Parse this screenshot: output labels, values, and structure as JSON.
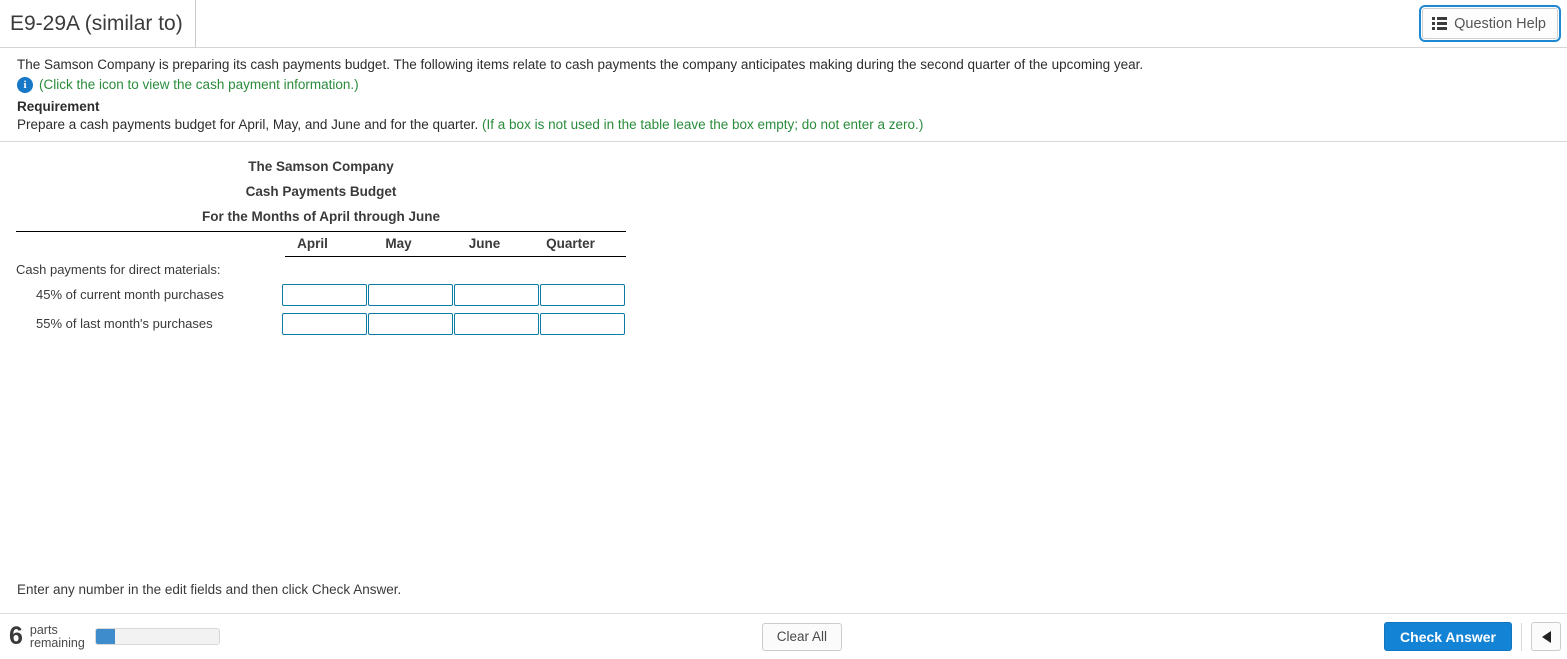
{
  "header": {
    "title": "E9-29A (similar to)",
    "question_help_label": "Question Help",
    "question_help_icon": "list-icon"
  },
  "problem": {
    "intro": "The Samson Company is preparing its cash payments budget. The following items relate to cash payments the company anticipates making during the second quarter of the upcoming year.",
    "info_icon": "info-icon",
    "info_link": "(Click the icon to view the cash payment information.)",
    "requirement_label": "Requirement",
    "requirement_text": "Prepare a cash payments budget for April, May, and June and for the quarter.",
    "requirement_hint": "(If a box is not used in the table leave the box empty; do not enter a zero.)"
  },
  "table": {
    "title_line1": "The Samson Company",
    "title_line2": "Cash Payments Budget",
    "title_line3": "For the Months of April through June",
    "columns": [
      "April",
      "May",
      "June",
      "Quarter"
    ],
    "section_label": "Cash payments for direct materials:",
    "rows": [
      {
        "label": "45% of current month purchases",
        "values": [
          "",
          "",
          "",
          ""
        ]
      },
      {
        "label": "55% of last month's purchases",
        "values": [
          "",
          "",
          "",
          ""
        ]
      }
    ]
  },
  "instruction": "Enter any number in the edit fields and then click Check Answer.",
  "footer": {
    "parts_count": "6",
    "parts_label_line1": "parts",
    "parts_label_line2": "remaining",
    "progress_percent": 16,
    "clear_all_label": "Clear All",
    "check_answer_label": "Check Answer",
    "prev_icon": "triangle-left-icon"
  },
  "colors": {
    "accent_blue": "#1383d6",
    "input_border": "#0c7ca5",
    "green": "#2a8c3c",
    "info_blue": "#1878c8",
    "progress_blue": "#3e8ccc"
  }
}
